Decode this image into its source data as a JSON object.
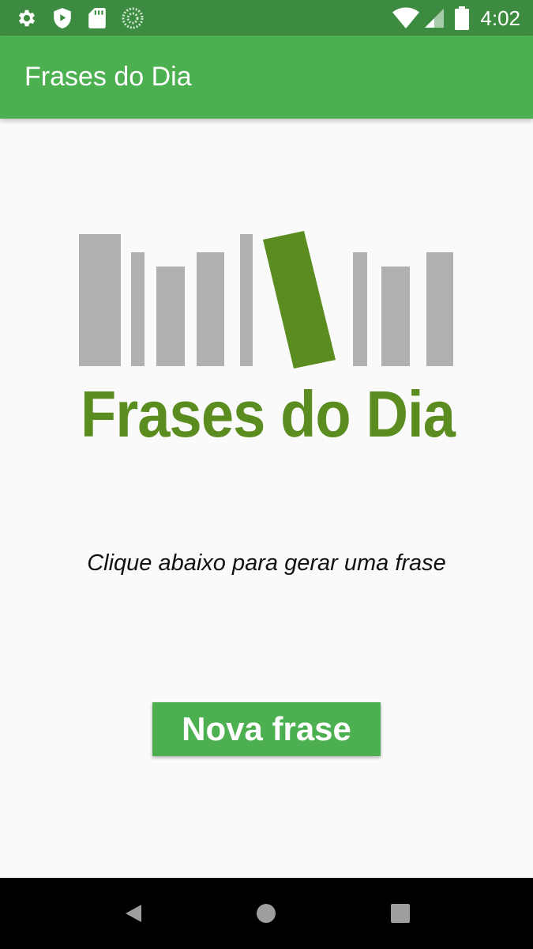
{
  "status_bar": {
    "time": "4:02",
    "left_icons": [
      "gear-icon",
      "shield-play-icon",
      "sd-card-icon",
      "sync-spinner-icon"
    ],
    "right_icons": [
      "wifi-icon",
      "cell-signal-icon",
      "battery-icon"
    ]
  },
  "app_bar": {
    "title": "Frases do Dia",
    "color": "#4caf50"
  },
  "logo": {
    "text": "Frases do Dia",
    "book_color": "#b0b0b0",
    "accent_color": "#5a8c1f"
  },
  "main": {
    "instruction": "Clique abaixo para gerar uma frase",
    "button_label": "Nova frase"
  },
  "nav_bar": {
    "icons": [
      "back-icon",
      "home-icon",
      "recents-icon"
    ]
  }
}
